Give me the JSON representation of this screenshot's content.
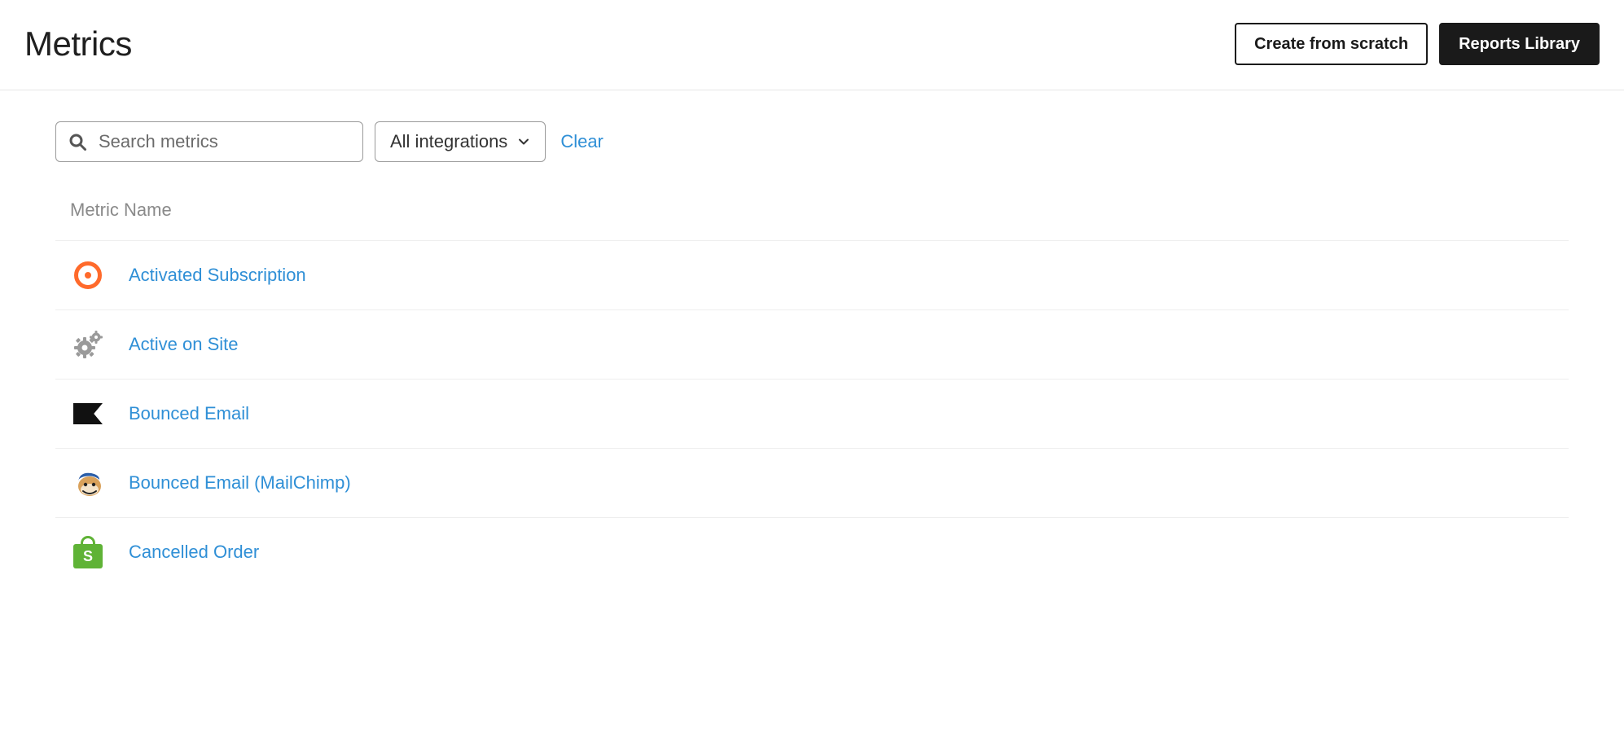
{
  "header": {
    "title": "Metrics",
    "create_label": "Create from scratch",
    "library_label": "Reports Library"
  },
  "filters": {
    "search_placeholder": "Search metrics",
    "integrations_label": "All integrations",
    "clear_label": "Clear"
  },
  "table": {
    "column_header": "Metric Name",
    "rows": [
      {
        "icon": "cratejoy",
        "label": "Activated Subscription"
      },
      {
        "icon": "gears",
        "label": "Active on Site"
      },
      {
        "icon": "flag",
        "label": "Bounced Email"
      },
      {
        "icon": "mailchimp",
        "label": "Bounced Email (MailChimp)"
      },
      {
        "icon": "shopify",
        "label": "Cancelled Order"
      }
    ]
  },
  "colors": {
    "link": "#2f8fd6",
    "orange": "#ff6a2b",
    "shopify_green": "#5fb336"
  }
}
